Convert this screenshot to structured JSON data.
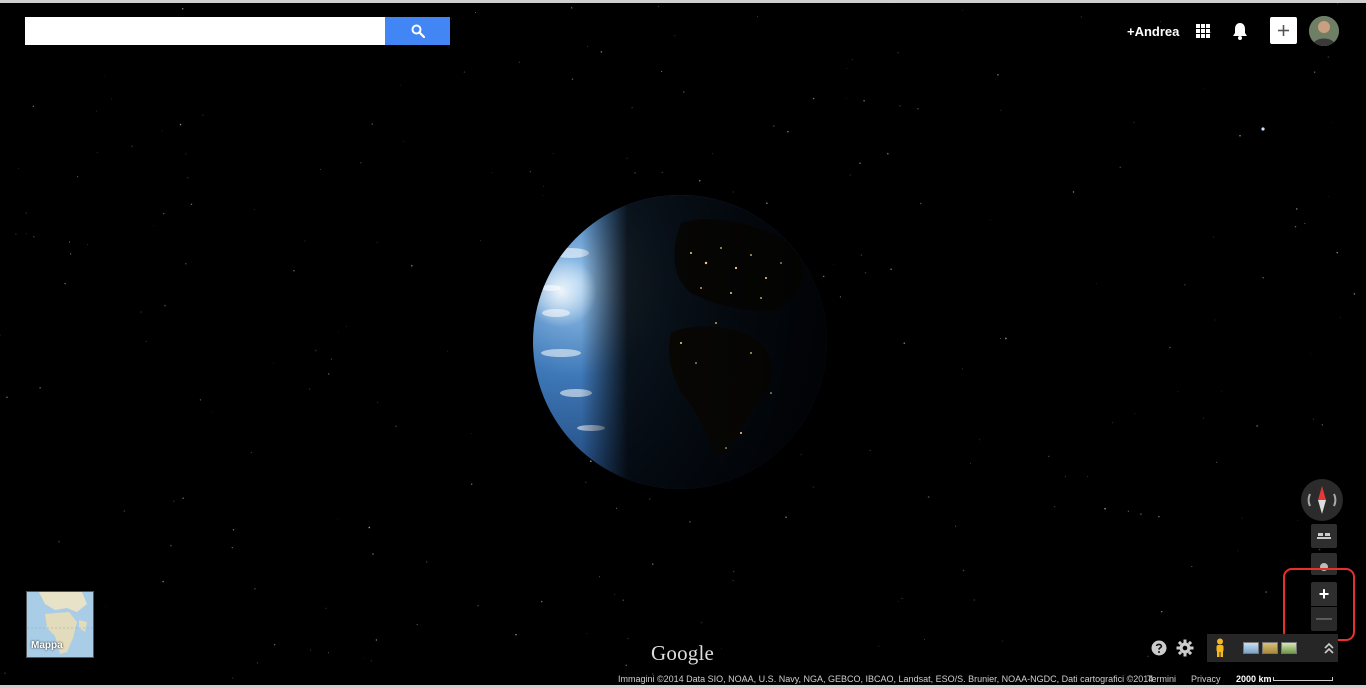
{
  "search": {
    "placeholder": "",
    "value": ""
  },
  "header": {
    "user_name": "+Andrea"
  },
  "controls": {
    "zoom_in_label": "+",
    "zoom_out_label": "—"
  },
  "minimap": {
    "label": "Mappa"
  },
  "branding": {
    "logo": "Google"
  },
  "footer": {
    "attribution": "Immagini ©2014 Data SIO, NOAA, U.S. Navy, NGA, GEBCO, IBCAO, Landsat, ESO/S. Brunier, NOAA-NGDC, Dati cartografici ©2014",
    "terms": "Termini",
    "privacy": "Privacy",
    "scale": "2000 km"
  },
  "colors": {
    "search_button": "#4285f4",
    "highlight": "#e8302a",
    "compass_north": "#e53935"
  },
  "icons": [
    "search-icon",
    "apps-grid-icon",
    "bell-icon",
    "plus-icon",
    "compass-icon",
    "tilt-icon",
    "locate-icon",
    "help-icon",
    "gear-icon",
    "pegman-icon",
    "chevron-up-icon"
  ]
}
